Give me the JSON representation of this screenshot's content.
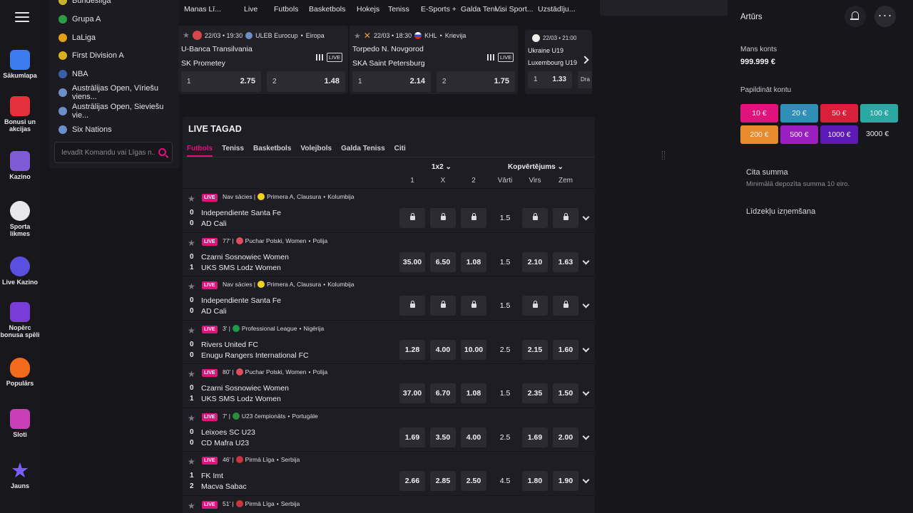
{
  "sidebar": {
    "items": [
      {
        "label": "Sākumlapa",
        "icon": "home-icon",
        "color": "#3d7bf0"
      },
      {
        "label": "Bonusi un akcijas",
        "icon": "gift-icon",
        "color": "#e4313c"
      },
      {
        "label": "Kazino",
        "icon": "cards-icon",
        "color": "#7f5bd6"
      },
      {
        "label": "Sporta likmes",
        "icon": "soccer-ball-icon",
        "color": "#e8e8ec"
      },
      {
        "label": "Live Kazino",
        "icon": "roulette-icon",
        "color": "#5b4fe0"
      },
      {
        "label": "Nopērc bonusa spēli",
        "icon": "ticket-icon",
        "color": "#7a3cd6"
      },
      {
        "label": "Populārs",
        "icon": "fire-icon",
        "color": "#f26a1b"
      },
      {
        "label": "Sloti",
        "icon": "slot-icon",
        "color": "#c93fb8"
      },
      {
        "label": "Jauns",
        "icon": "star-icon",
        "color": "#7b5cff"
      }
    ]
  },
  "sports_list": {
    "items": [
      {
        "label": "Bundesliga",
        "flag": "#c9b130"
      },
      {
        "label": "Grupa A",
        "flag": "#2a9d46"
      },
      {
        "label": "LaLiga",
        "flag": "#e2a218"
      },
      {
        "label": "First Division A",
        "flag": "#d8b21c"
      },
      {
        "label": "NBA",
        "flag": "#3a5fa8"
      },
      {
        "label": "Austrālijas Open, Vīriešu viens...",
        "flag": "#6d8fc8"
      },
      {
        "label": "Austrālijas Open, Sieviešu vie...",
        "flag": "#6d8fc8"
      },
      {
        "label": "Six Nations",
        "flag": "#6d8fc8"
      }
    ],
    "search_placeholder": "Ievadīt Komandu vai Līgas n..."
  },
  "top_tabs": [
    "Manas Lī...",
    "Live",
    "Futbols",
    "Basketbols",
    "Hokejs",
    "Teniss",
    "E-Sports +",
    "Galda Teni...",
    "Visi Sport...",
    "Uzstādīju..."
  ],
  "featured": [
    {
      "time": "22/03 • 19:30",
      "league": "ULEB Eurocup",
      "region": "Eiropa",
      "team1": "U-Banca Transilvania",
      "team2": "SK Prometey",
      "live": "LIVE",
      "odds": [
        {
          "label": "1",
          "value": "2.75"
        },
        {
          "label": "2",
          "value": "1.48"
        }
      ]
    },
    {
      "time": "22/03 • 18:30",
      "league": "KHL",
      "region": "Krievija",
      "team1": "Torpedo N. Novgorod",
      "team2": "SKA Saint Petersburg",
      "live": "LIVE",
      "odds": [
        {
          "label": "1",
          "value": "2.14"
        },
        {
          "label": "2",
          "value": "1.75"
        }
      ]
    },
    {
      "time": "22/03 • 21:00",
      "team1": "Ukraine U19",
      "team2": "Luxembourg U19",
      "odds": [
        {
          "label": "1",
          "value": "1.33"
        },
        {
          "label": "Dra",
          "value": ""
        }
      ]
    }
  ],
  "live_now": {
    "title": "LIVE TAGAD",
    "tabs": [
      "Futbols",
      "Teniss",
      "Basketbols",
      "Volejbols",
      "Galda Teniss",
      "Citi"
    ],
    "group1": "1x2",
    "group2": "Kopvērtējums",
    "cols": [
      "1",
      "X",
      "2",
      "Vārti",
      "Virs",
      "Zem"
    ],
    "live_label": "LIVE",
    "matches": [
      {
        "status": "Nav sācies |",
        "league": "Primera A, Clausura",
        "country": "Kolumbija",
        "flag": "#f2d21b",
        "s1": "0",
        "s2": "0",
        "t1": "Independiente Santa Fe",
        "t2": "AD Cali",
        "odds": [
          "lock",
          "lock",
          "lock",
          "1.5",
          "lock",
          "lock"
        ]
      },
      {
        "status": "77' |",
        "league": "Puchar Polski, Women",
        "country": "Polija",
        "flag": "#e44a5a",
        "s1": "0",
        "s2": "1",
        "t1": "Czarni Sosnowiec Women",
        "t2": "UKS SMS Lodz Women",
        "odds": [
          "35.00",
          "6.50",
          "1.08",
          "1.5",
          "2.10",
          "1.63"
        ]
      },
      {
        "status": "Nav sācies |",
        "league": "Primera A, Clausura",
        "country": "Kolumbija",
        "flag": "#f2d21b",
        "s1": "0",
        "s2": "0",
        "t1": "Independiente Santa Fe",
        "t2": "AD Cali",
        "odds": [
          "lock",
          "lock",
          "lock",
          "1.5",
          "lock",
          "lock"
        ]
      },
      {
        "status": "3' |",
        "league": "Professional League",
        "country": "Nigērija",
        "flag": "#1e9a48",
        "s1": "0",
        "s2": "0",
        "t1": "Rivers United FC",
        "t2": "Enugu Rangers International FC",
        "odds": [
          "1.28",
          "4.00",
          "10.00",
          "2.5",
          "2.15",
          "1.60"
        ]
      },
      {
        "status": "80' |",
        "league": "Puchar Polski, Women",
        "country": "Polija",
        "flag": "#e44a5a",
        "s1": "0",
        "s2": "1",
        "t1": "Czarni Sosnowiec Women",
        "t2": "UKS SMS Lodz Women",
        "odds": [
          "37.00",
          "6.70",
          "1.08",
          "1.5",
          "2.35",
          "1.50"
        ]
      },
      {
        "status": "7' |",
        "league": "U23 čempionāts",
        "country": "Portugāle",
        "flag": "#2b8a3e",
        "s1": "0",
        "s2": "0",
        "t1": "Leixoes SC U23",
        "t2": "CD Mafra U23",
        "odds": [
          "1.69",
          "3.50",
          "4.00",
          "2.5",
          "1.69",
          "2.00"
        ]
      },
      {
        "status": "46' |",
        "league": "Pirmā Līga",
        "country": "Serbija",
        "flag": "#c9363e",
        "s1": "1",
        "s2": "2",
        "t1": "FK Imt",
        "t2": "Macva Sabac",
        "odds": [
          "2.66",
          "2.85",
          "2.50",
          "4.5",
          "1.80",
          "1.90"
        ]
      },
      {
        "status": "51' |",
        "league": "Pirmā Līga",
        "country": "Serbija",
        "flag": "#c9363e",
        "s1": "",
        "s2": "",
        "t1": "",
        "t2": "",
        "odds": []
      }
    ]
  },
  "account": {
    "name": "Artūrs",
    "my_account": "Mans konts",
    "balance": "999.999 €",
    "topup_label": "Papildināt kontu",
    "chips": [
      {
        "label": "10 €",
        "color": "#e0127b"
      },
      {
        "label": "20 €",
        "color": "#2f8fb6"
      },
      {
        "label": "50 €",
        "color": "#d8203a"
      },
      {
        "label": "100 €",
        "color": "#2aa8a3"
      },
      {
        "label": "200 €",
        "color": "#e88b2c"
      },
      {
        "label": "500 €",
        "color": "#9a1fbf"
      },
      {
        "label": "1000 €",
        "color": "#5b1ab5"
      }
    ],
    "chip_plain": "3000 €",
    "other_amount": "Cita summa",
    "min_deposit": "Minimālā depozīta summa 10 eiro.",
    "withdraw": "Līdzekļu izņemšana"
  }
}
